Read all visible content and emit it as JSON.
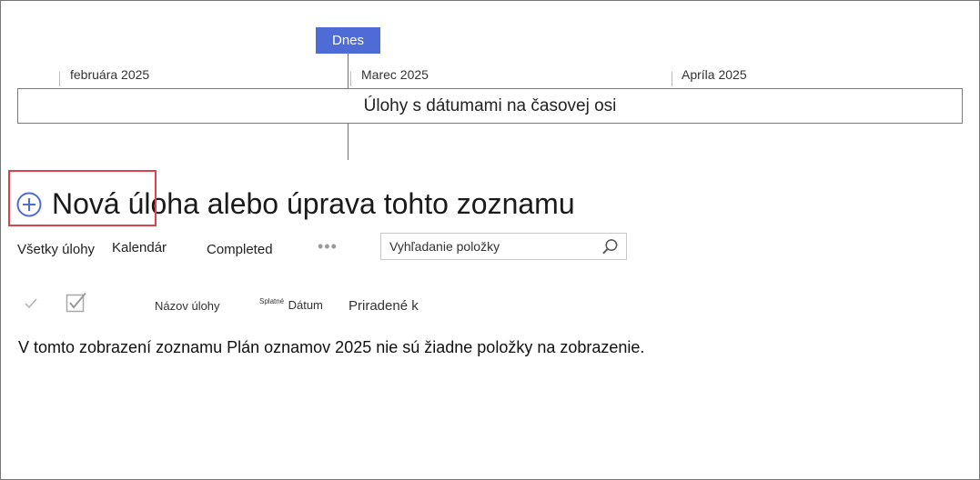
{
  "timeline": {
    "today_label": "Dnes",
    "months": [
      "februára 2025",
      "Marec 2025",
      "Apríla 2025"
    ],
    "bar_label": "Úlohy s dátumami na časovej osi",
    "today_color": "#4f6bd6"
  },
  "new_task": {
    "label": "Nová úloha alebo úprava tohto zoznamu",
    "icon": "plus-circle-icon",
    "highlight_color": "#d9434b"
  },
  "views": {
    "tabs": [
      "Všetky úlohy",
      "Kalendár",
      "Completed"
    ],
    "more_icon": "ellipsis-icon"
  },
  "search": {
    "placeholder": "Vyhľadanie položky",
    "icon": "search-icon"
  },
  "columns": {
    "done_icon": "checkmark-icon",
    "select_icon": "select-all-checkbox-icon",
    "task_name": "Názov úlohy",
    "due_prefix": "Splatné",
    "due_date": "Dátum",
    "assigned_to": "Priradené k"
  },
  "list": {
    "empty_message": "V tomto zobrazení zoznamu Plán oznamov 2025 nie sú žiadne položky na zobrazenie."
  }
}
